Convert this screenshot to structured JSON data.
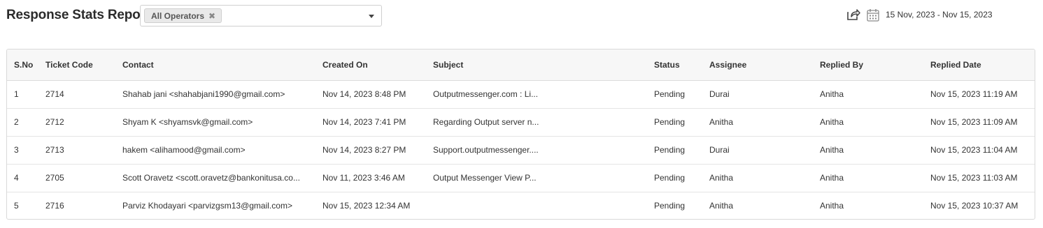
{
  "header": {
    "title": "Response Stats Report",
    "operator_filter": {
      "chips": [
        "All Operators"
      ],
      "remove_glyph": "✖"
    },
    "date_range": "15 Nov, 2023 - Nov 15, 2023",
    "icons": {
      "export": "share-export-icon",
      "calendar": "calendar-icon"
    }
  },
  "table": {
    "columns": [
      "S.No",
      "Ticket Code",
      "Contact",
      "Created On",
      "Subject",
      "Status",
      "Assignee",
      "Replied By",
      "Replied Date"
    ],
    "rows": [
      [
        "1",
        "2714",
        "Shahab jani <shahabjani1990@gmail.com>",
        "Nov 14, 2023 8:48 PM",
        "Outputmessenger.com : Li...",
        "Pending",
        "Durai",
        "Anitha",
        "Nov 15, 2023 11:19 AM"
      ],
      [
        "2",
        "2712",
        "Shyam K <shyamsvk@gmail.com>",
        "Nov 14, 2023 7:41 PM",
        "Regarding Output server n...",
        "Pending",
        "Anitha",
        "Anitha",
        "Nov 15, 2023 11:09 AM"
      ],
      [
        "3",
        "2713",
        "hakem <alihamood@gmail.com>",
        "Nov 14, 2023 8:27 PM",
        "Support.outputmessenger....",
        "Pending",
        "Durai",
        "Anitha",
        "Nov 15, 2023 11:04 AM"
      ],
      [
        "4",
        "2705",
        "Scott Oravetz <scott.oravetz@bankonitusa.co...",
        "Nov 11, 2023 3:46 AM",
        "Output Messenger View P...",
        "Pending",
        "Anitha",
        "Anitha",
        "Nov 15, 2023 11:03 AM"
      ],
      [
        "5",
        "2716",
        "Parviz Khodayari <parvizgsm13@gmail.com>",
        "Nov 15, 2023 12:34 AM",
        "",
        "Pending",
        "Anitha",
        "Anitha",
        "Nov 15, 2023 10:37 AM"
      ]
    ]
  }
}
